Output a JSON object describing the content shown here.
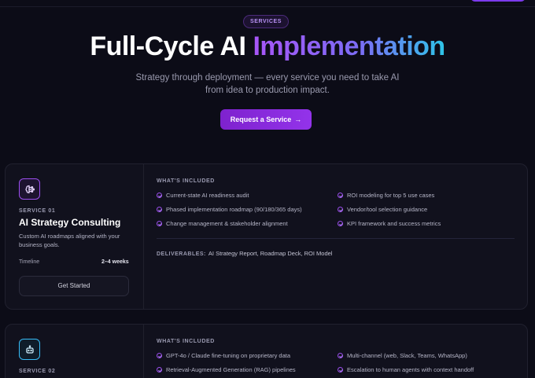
{
  "hero": {
    "badge": "SERVICES",
    "title_main": "Full-Cycle AI ",
    "title_highlight": "Implementation",
    "subtitle_line1": "Strategy through deployment — every service you need to take AI",
    "subtitle_line2": "from idea to production impact.",
    "cta_label": "Request a Service",
    "cta_arrow": "→"
  },
  "colors": {
    "background": "#0c0c17",
    "card": "#11111d",
    "accent_purple": "#9333ea",
    "accent_gradient_end": "#2ec5e8",
    "accent_blue": "#38bdf8"
  },
  "services": [
    {
      "number": "SERVICE 01",
      "name": "AI Strategy Consulting",
      "description": "Custom AI roadmaps aligned with your business goals.",
      "icon": "brain-icon",
      "timeline_label": "Timeline",
      "timeline_value": "2–4 weeks",
      "button_label": "Get Started",
      "included_heading": "WHAT'S INCLUDED",
      "features": [
        "Current-state AI readiness audit",
        "Phased implementation roadmap (90/180/365 days)",
        "Change management & stakeholder alignment",
        "ROI modeling for top 5 use cases",
        "Vendor/tool selection guidance",
        "KPI framework and success metrics"
      ],
      "deliverables_label": "DELIVERABLES:",
      "deliverables": "AI Strategy Report, Roadmap Deck, ROI Model"
    },
    {
      "number": "SERVICE 02",
      "icon": "bot-icon",
      "included_heading": "WHAT'S INCLUDED",
      "features": [
        "GPT-4o / Claude fine-tuning on proprietary data",
        "Retrieval-Augmented Generation (RAG) pipelines",
        "Multi-channel (web, Slack, Teams, WhatsApp)",
        "Escalation to human agents with context handoff"
      ]
    }
  ]
}
